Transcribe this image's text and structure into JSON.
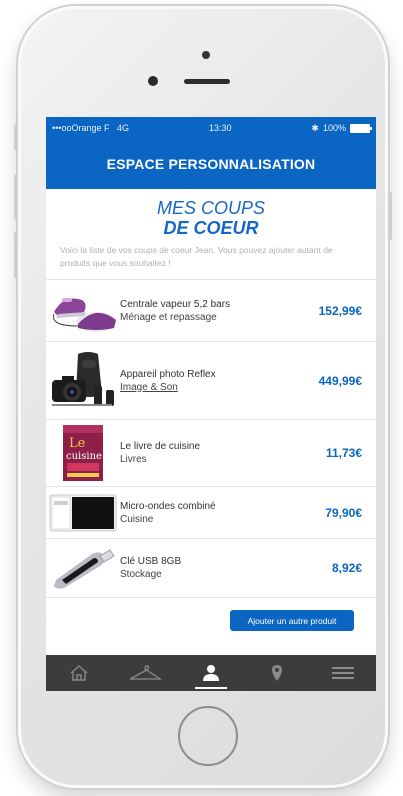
{
  "status_bar": {
    "carrier": "•••ooOrange F",
    "network": "4G",
    "time": "13:30",
    "bluetooth": "✱",
    "battery": "100%"
  },
  "header": {
    "title": "ESPACE PERSONNALISATION"
  },
  "hero": {
    "line1": "MES COUPS",
    "line2": "DE COEUR"
  },
  "intro": "Voici la liste de vos coups de coeur Jean. Vous pouvez ajouter autant de produits que vous souhaitez !",
  "products": [
    {
      "name": "Centrale vapeur 5,2 bars",
      "category": "Ménage et repassage",
      "price": "152,99€",
      "icon": "steam-iron-icon"
    },
    {
      "name": "Appareil photo Reflex",
      "category": "Image & Son",
      "price": "449,99€",
      "icon": "camera-icon"
    },
    {
      "name": "Le livre de cuisine",
      "category": "Livres",
      "price": "11,73€",
      "icon": "cookbook-icon"
    },
    {
      "name": "Micro-ondes combiné",
      "category": "Cuisine",
      "price": "79,90€",
      "icon": "microwave-icon"
    },
    {
      "name": "Clé USB 8GB",
      "category": "Stockage",
      "price": "8,92€",
      "icon": "usb-key-icon"
    }
  ],
  "add_button": "Ajouter un autre produit",
  "tabbar": {
    "items": [
      "home-icon",
      "hanger-icon",
      "user-icon",
      "location-pin-icon",
      "menu-icon"
    ],
    "active": "user-icon"
  },
  "colors": {
    "brand": "#0a66c2",
    "tabbar": "#3c3c3c"
  }
}
